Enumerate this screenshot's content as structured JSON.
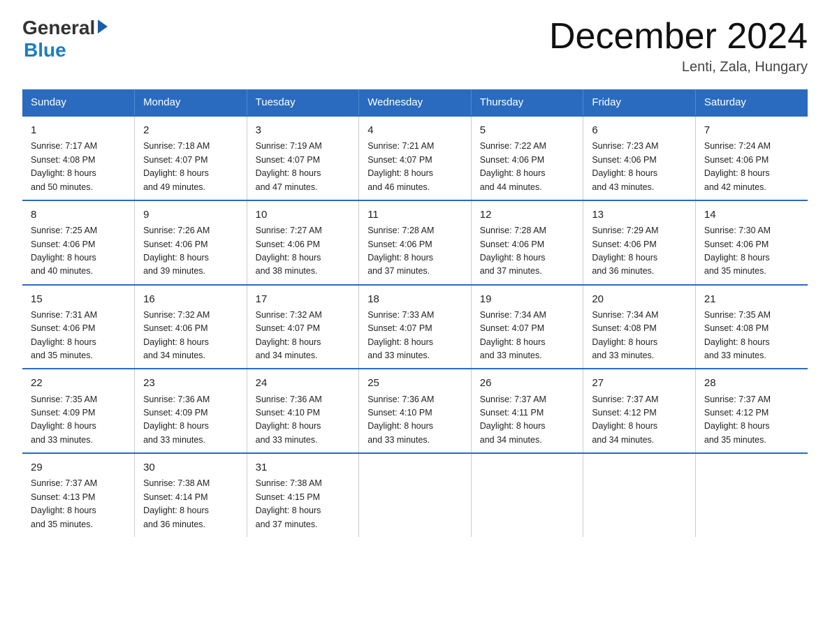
{
  "logo": {
    "general": "General",
    "blue": "Blue"
  },
  "title": "December 2024",
  "subtitle": "Lenti, Zala, Hungary",
  "days_of_week": [
    "Sunday",
    "Monday",
    "Tuesday",
    "Wednesday",
    "Thursday",
    "Friday",
    "Saturday"
  ],
  "weeks": [
    [
      {
        "day": "1",
        "info": "Sunrise: 7:17 AM\nSunset: 4:08 PM\nDaylight: 8 hours\nand 50 minutes."
      },
      {
        "day": "2",
        "info": "Sunrise: 7:18 AM\nSunset: 4:07 PM\nDaylight: 8 hours\nand 49 minutes."
      },
      {
        "day": "3",
        "info": "Sunrise: 7:19 AM\nSunset: 4:07 PM\nDaylight: 8 hours\nand 47 minutes."
      },
      {
        "day": "4",
        "info": "Sunrise: 7:21 AM\nSunset: 4:07 PM\nDaylight: 8 hours\nand 46 minutes."
      },
      {
        "day": "5",
        "info": "Sunrise: 7:22 AM\nSunset: 4:06 PM\nDaylight: 8 hours\nand 44 minutes."
      },
      {
        "day": "6",
        "info": "Sunrise: 7:23 AM\nSunset: 4:06 PM\nDaylight: 8 hours\nand 43 minutes."
      },
      {
        "day": "7",
        "info": "Sunrise: 7:24 AM\nSunset: 4:06 PM\nDaylight: 8 hours\nand 42 minutes."
      }
    ],
    [
      {
        "day": "8",
        "info": "Sunrise: 7:25 AM\nSunset: 4:06 PM\nDaylight: 8 hours\nand 40 minutes."
      },
      {
        "day": "9",
        "info": "Sunrise: 7:26 AM\nSunset: 4:06 PM\nDaylight: 8 hours\nand 39 minutes."
      },
      {
        "day": "10",
        "info": "Sunrise: 7:27 AM\nSunset: 4:06 PM\nDaylight: 8 hours\nand 38 minutes."
      },
      {
        "day": "11",
        "info": "Sunrise: 7:28 AM\nSunset: 4:06 PM\nDaylight: 8 hours\nand 37 minutes."
      },
      {
        "day": "12",
        "info": "Sunrise: 7:28 AM\nSunset: 4:06 PM\nDaylight: 8 hours\nand 37 minutes."
      },
      {
        "day": "13",
        "info": "Sunrise: 7:29 AM\nSunset: 4:06 PM\nDaylight: 8 hours\nand 36 minutes."
      },
      {
        "day": "14",
        "info": "Sunrise: 7:30 AM\nSunset: 4:06 PM\nDaylight: 8 hours\nand 35 minutes."
      }
    ],
    [
      {
        "day": "15",
        "info": "Sunrise: 7:31 AM\nSunset: 4:06 PM\nDaylight: 8 hours\nand 35 minutes."
      },
      {
        "day": "16",
        "info": "Sunrise: 7:32 AM\nSunset: 4:06 PM\nDaylight: 8 hours\nand 34 minutes."
      },
      {
        "day": "17",
        "info": "Sunrise: 7:32 AM\nSunset: 4:07 PM\nDaylight: 8 hours\nand 34 minutes."
      },
      {
        "day": "18",
        "info": "Sunrise: 7:33 AM\nSunset: 4:07 PM\nDaylight: 8 hours\nand 33 minutes."
      },
      {
        "day": "19",
        "info": "Sunrise: 7:34 AM\nSunset: 4:07 PM\nDaylight: 8 hours\nand 33 minutes."
      },
      {
        "day": "20",
        "info": "Sunrise: 7:34 AM\nSunset: 4:08 PM\nDaylight: 8 hours\nand 33 minutes."
      },
      {
        "day": "21",
        "info": "Sunrise: 7:35 AM\nSunset: 4:08 PM\nDaylight: 8 hours\nand 33 minutes."
      }
    ],
    [
      {
        "day": "22",
        "info": "Sunrise: 7:35 AM\nSunset: 4:09 PM\nDaylight: 8 hours\nand 33 minutes."
      },
      {
        "day": "23",
        "info": "Sunrise: 7:36 AM\nSunset: 4:09 PM\nDaylight: 8 hours\nand 33 minutes."
      },
      {
        "day": "24",
        "info": "Sunrise: 7:36 AM\nSunset: 4:10 PM\nDaylight: 8 hours\nand 33 minutes."
      },
      {
        "day": "25",
        "info": "Sunrise: 7:36 AM\nSunset: 4:10 PM\nDaylight: 8 hours\nand 33 minutes."
      },
      {
        "day": "26",
        "info": "Sunrise: 7:37 AM\nSunset: 4:11 PM\nDaylight: 8 hours\nand 34 minutes."
      },
      {
        "day": "27",
        "info": "Sunrise: 7:37 AM\nSunset: 4:12 PM\nDaylight: 8 hours\nand 34 minutes."
      },
      {
        "day": "28",
        "info": "Sunrise: 7:37 AM\nSunset: 4:12 PM\nDaylight: 8 hours\nand 35 minutes."
      }
    ],
    [
      {
        "day": "29",
        "info": "Sunrise: 7:37 AM\nSunset: 4:13 PM\nDaylight: 8 hours\nand 35 minutes."
      },
      {
        "day": "30",
        "info": "Sunrise: 7:38 AM\nSunset: 4:14 PM\nDaylight: 8 hours\nand 36 minutes."
      },
      {
        "day": "31",
        "info": "Sunrise: 7:38 AM\nSunset: 4:15 PM\nDaylight: 8 hours\nand 37 minutes."
      },
      {
        "day": "",
        "info": ""
      },
      {
        "day": "",
        "info": ""
      },
      {
        "day": "",
        "info": ""
      },
      {
        "day": "",
        "info": ""
      }
    ]
  ]
}
